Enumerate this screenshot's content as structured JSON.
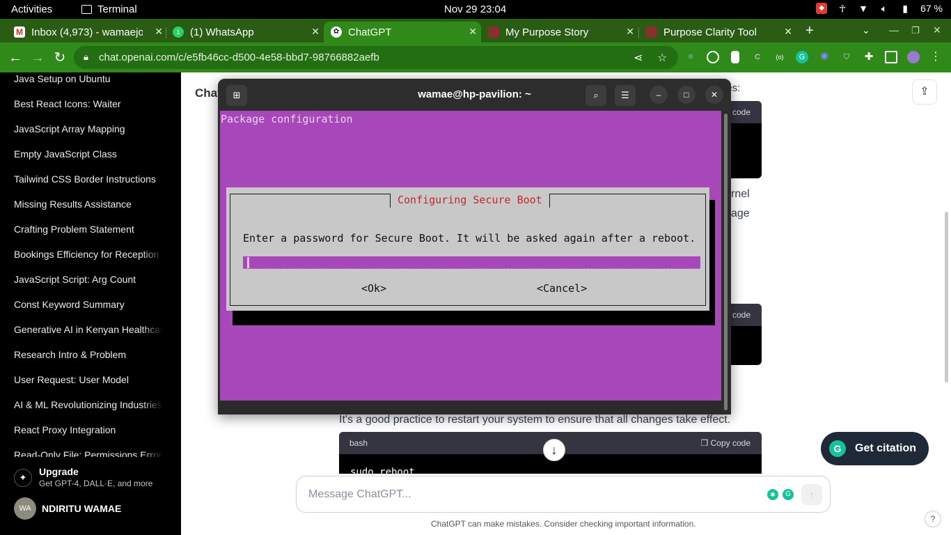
{
  "topbar": {
    "activities": "Activities",
    "app_name": "Terminal",
    "clock": "Nov 29  23:04",
    "battery": "67 %"
  },
  "browser": {
    "tabs": [
      {
        "label": "Inbox (4,973) - wamaejo",
        "icon": "gmail-icon"
      },
      {
        "label": "(1) WhatsApp",
        "icon": "whatsapp-icon"
      },
      {
        "label": "ChatGPT",
        "icon": "chatgpt-icon",
        "active": true
      },
      {
        "label": "My Purpose Story",
        "icon": "page-icon"
      },
      {
        "label": "Purpose Clarity Tool",
        "icon": "page-icon"
      }
    ],
    "url": "chat.openai.com/c/e5fb46cc-d500-4e58-bbd7-98766882aefb"
  },
  "sidebar": {
    "items": [
      {
        "label": "Java Setup on Ubuntu"
      },
      {
        "label": "Best React Icons: Waiter"
      },
      {
        "label": "JavaScript Array Mapping"
      },
      {
        "label": "Empty JavaScript Class"
      },
      {
        "label": "Tailwind CSS Border Instructions"
      },
      {
        "label": "Missing Results Assistance"
      },
      {
        "label": "Crafting Problem Statement"
      },
      {
        "label": "Bookings Efficiency for Reception"
      },
      {
        "label": "JavaScript Script: Arg Count"
      },
      {
        "label": "Const Keyword Summary"
      },
      {
        "label": "Generative AI in Kenyan Healthcare"
      },
      {
        "label": "Research Intro & Problem"
      },
      {
        "label": "User Request: User Model"
      },
      {
        "label": "AI & ML Revolutionizing Industries"
      },
      {
        "label": "React Proxy Integration"
      },
      {
        "label": "Read-Only File: Permissions Error"
      }
    ],
    "upgrade_title": "Upgrade",
    "upgrade_sub": "Get GPT-4, DALL·E, and more",
    "user_initials": "WA",
    "user_name": "NDIRITU WAMAE"
  },
  "main": {
    "title_partial": "Chat",
    "code_blocks": [
      {
        "lang": "",
        "copy": "code",
        "code": ""
      },
      {
        "lang": "",
        "copy": "code",
        "code": ""
      },
      {
        "lang": "bash",
        "copy": "Copy code",
        "code": "sudo reboot"
      }
    ],
    "fragments": [
      "ges:",
      "rnel",
      "age",
      "s"
    ],
    "restart_text": "It's a good practice to restart your system to ensure that all changes take effect.",
    "citation_label": "Get citation",
    "composer_placeholder": "Message ChatGPT...",
    "disclaimer": "ChatGPT can make mistakes. Consider checking important information.",
    "help": "?"
  },
  "terminal": {
    "title": "wamae@hp-pavilion: ~",
    "package_title": "Package configuration",
    "dialog_title": "Configuring Secure Boot",
    "dialog_message": "Enter a password for Secure Boot. It will be asked again after a reboot.",
    "ok_label": "<Ok>",
    "cancel_label": "<Cancel>"
  },
  "colors": {
    "browser_frame": "#2f8a1a",
    "tabstrip": "#2a5c14",
    "terminal_bg": "#a847b9",
    "dialog_bg": "#c8c8c8",
    "dialog_title": "#c62828"
  }
}
